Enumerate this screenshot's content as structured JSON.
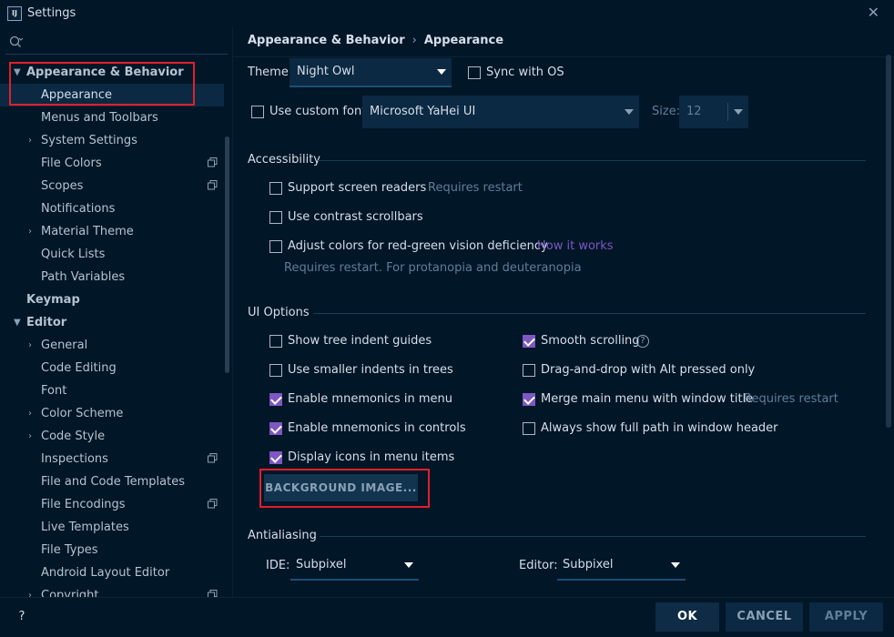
{
  "window": {
    "title": "Settings",
    "app_icon_text": "IJ"
  },
  "sidebar": {
    "items": [
      {
        "label": "Appearance & Behavior",
        "expanded": true
      },
      {
        "label": "Appearance"
      },
      {
        "label": "Menus and Toolbars"
      },
      {
        "label": "System Settings"
      },
      {
        "label": "File Colors"
      },
      {
        "label": "Scopes"
      },
      {
        "label": "Notifications"
      },
      {
        "label": "Material Theme"
      },
      {
        "label": "Quick Lists"
      },
      {
        "label": "Path Variables"
      },
      {
        "label": "Keymap"
      },
      {
        "label": "Editor",
        "expanded": true
      },
      {
        "label": "General"
      },
      {
        "label": "Code Editing"
      },
      {
        "label": "Font"
      },
      {
        "label": "Color Scheme"
      },
      {
        "label": "Code Style"
      },
      {
        "label": "Inspections"
      },
      {
        "label": "File and Code Templates"
      },
      {
        "label": "File Encodings"
      },
      {
        "label": "Live Templates"
      },
      {
        "label": "File Types"
      },
      {
        "label": "Android Layout Editor"
      },
      {
        "label": "Copyright"
      }
    ]
  },
  "breadcrumb": {
    "parent": "Appearance & Behavior",
    "separator": "›",
    "current": "Appearance"
  },
  "theme": {
    "label": "Theme:",
    "value": "Night Owl",
    "sync_label": "Sync with OS",
    "sync_checked": false
  },
  "font": {
    "custom_label": "Use custom font:",
    "custom_checked": false,
    "value": "Microsoft YaHei UI",
    "size_label": "Size:",
    "size_value": "12"
  },
  "accessibility": {
    "title": "Accessibility",
    "screen_readers": "Support screen readers",
    "screen_readers_note": "Requires restart",
    "contrast_scrollbars": "Use contrast scrollbars",
    "adjust_colors": "Adjust colors for red-green vision deficiency",
    "how_it_works": "How it works",
    "adjust_note": "Requires restart. For protanopia and deuteranopia"
  },
  "ui_options": {
    "title": "UI Options",
    "tree_indent": "Show tree indent guides",
    "smaller_indents": "Use smaller indents in trees",
    "mnemonics_menu": "Enable mnemonics in menu",
    "mnemonics_controls": "Enable mnemonics in controls",
    "display_icons": "Display icons in menu items",
    "smooth_scrolling": "Smooth scrolling",
    "help_glyph": "?",
    "drag_drop": "Drag-and-drop with Alt pressed only",
    "merge_menu": "Merge main menu with window title",
    "merge_note": "Requires restart",
    "full_path": "Always show full path in window header",
    "background_button": "BACKGROUND IMAGE..."
  },
  "antialiasing": {
    "title": "Antialiasing",
    "ide_label": "IDE:",
    "ide_value": "Subpixel",
    "editor_label": "Editor:",
    "editor_value": "Subpixel"
  },
  "footer": {
    "help": "?",
    "ok": "OK",
    "cancel": "CANCEL",
    "apply": "APPLY"
  },
  "colors": {
    "background": "#011627",
    "accent": "#7e57c2",
    "highlight_box": "#e0202a"
  }
}
